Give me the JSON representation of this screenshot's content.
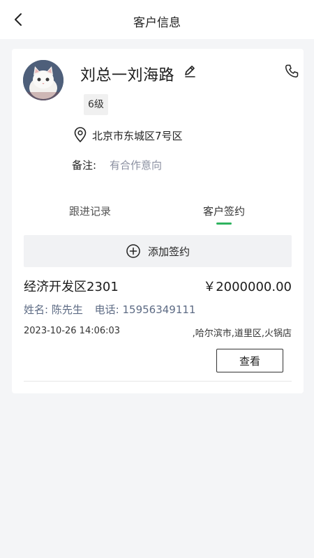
{
  "header": {
    "title": "客户信息"
  },
  "customer": {
    "name": "刘总一刘海路",
    "level": "6级",
    "address": "北京市东城区7号区",
    "remark_label": "备注:",
    "remark_value": "有合作意向"
  },
  "tabs": [
    {
      "label": "跟进记录",
      "active": false
    },
    {
      "label": "客户签约",
      "active": true
    }
  ],
  "add_signing": {
    "label": "添加签约"
  },
  "contract": {
    "title": "经济开发区2301",
    "amount": "￥2000000.00",
    "name_label": "姓名:",
    "name_value": "陈先生",
    "phone_label": "电话:",
    "phone_value": "15956349111",
    "datetime": "2023-10-26 14:06:03",
    "location": ",哈尔滨市,道里区,火锅店",
    "view_label": "查看"
  },
  "colors": {
    "accent": "#2fb35f",
    "background": "#f4f5f7",
    "muted_text": "#8a8fa0"
  },
  "icons": [
    "back-arrow-icon",
    "edit-icon",
    "phone-icon",
    "location-pin-icon",
    "plus-circle-icon"
  ]
}
